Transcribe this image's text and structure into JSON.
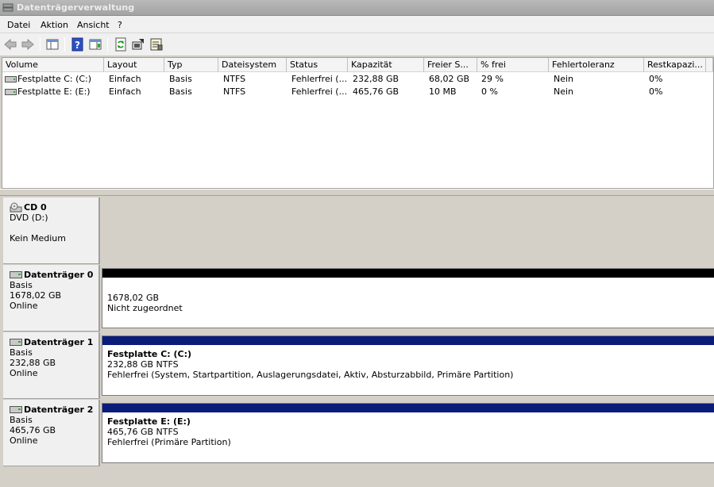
{
  "window": {
    "title": "Datenträgerverwaltung"
  },
  "menu": [
    {
      "label": "Datei"
    },
    {
      "label": "Aktion"
    },
    {
      "label": "Ansicht"
    },
    {
      "label": "?"
    }
  ],
  "toolbar": {
    "icons": [
      "back-icon",
      "forward-icon",
      "console-tree-icon",
      "help-icon",
      "action-pane-icon",
      "refresh-icon",
      "rescan-disks-icon",
      "properties-icon"
    ]
  },
  "volume_table": {
    "columns": [
      "Volume",
      "Layout",
      "Typ",
      "Dateisystem",
      "Status",
      "Kapazität",
      "Freier S...",
      "% frei",
      "Fehlertoleranz",
      "Restkapazi..."
    ],
    "rows": [
      {
        "volume": "Festplatte C: (C:)",
        "layout": "Einfach",
        "typ": "Basis",
        "dateisystem": "NTFS",
        "status": "Fehlerfrei (...",
        "kapazitaet": "232,88 GB",
        "frei": "68,02 GB",
        "prozent_frei": "29 %",
        "fehlertoleranz": "Nein",
        "restkapazitaet": "0%"
      },
      {
        "volume": "Festplatte E: (E:)",
        "layout": "Einfach",
        "typ": "Basis",
        "dateisystem": "NTFS",
        "status": "Fehlerfrei (...",
        "kapazitaet": "465,76 GB",
        "frei": "10 MB",
        "prozent_frei": "0 %",
        "fehlertoleranz": "Nein",
        "restkapazitaet": "0%"
      }
    ]
  },
  "disks": [
    {
      "name": "CD 0",
      "line1": "DVD (D:)",
      "line2": "",
      "line3": "Kein Medium",
      "icon": "cd-drive-icon"
    },
    {
      "name": "Datenträger 0",
      "line1": "Basis",
      "line2": "1678,02 GB",
      "line3": "Online",
      "icon": "disk-icon",
      "partition": {
        "title": "",
        "size": "1678,02 GB",
        "status": "Nicht zugeordnet",
        "bar_color": "#000000"
      }
    },
    {
      "name": "Datenträger 1",
      "line1": "Basis",
      "line2": "232,88 GB",
      "line3": "Online",
      "icon": "disk-icon",
      "partition": {
        "title": "Festplatte C:  (C:)",
        "size": "232,88 GB NTFS",
        "status": "Fehlerfrei (System, Startpartition, Auslagerungsdatei, Aktiv, Absturzabbild, Primäre Partition)",
        "bar_color": "#0a1b7a"
      }
    },
    {
      "name": "Datenträger 2",
      "line1": "Basis",
      "line2": "465,76 GB",
      "line3": "Online",
      "icon": "disk-icon",
      "partition": {
        "title": "Festplatte E:  (E:)",
        "size": "465,76 GB NTFS",
        "status": "Fehlerfrei (Primäre Partition)",
        "bar_color": "#0a1b7a"
      }
    }
  ]
}
